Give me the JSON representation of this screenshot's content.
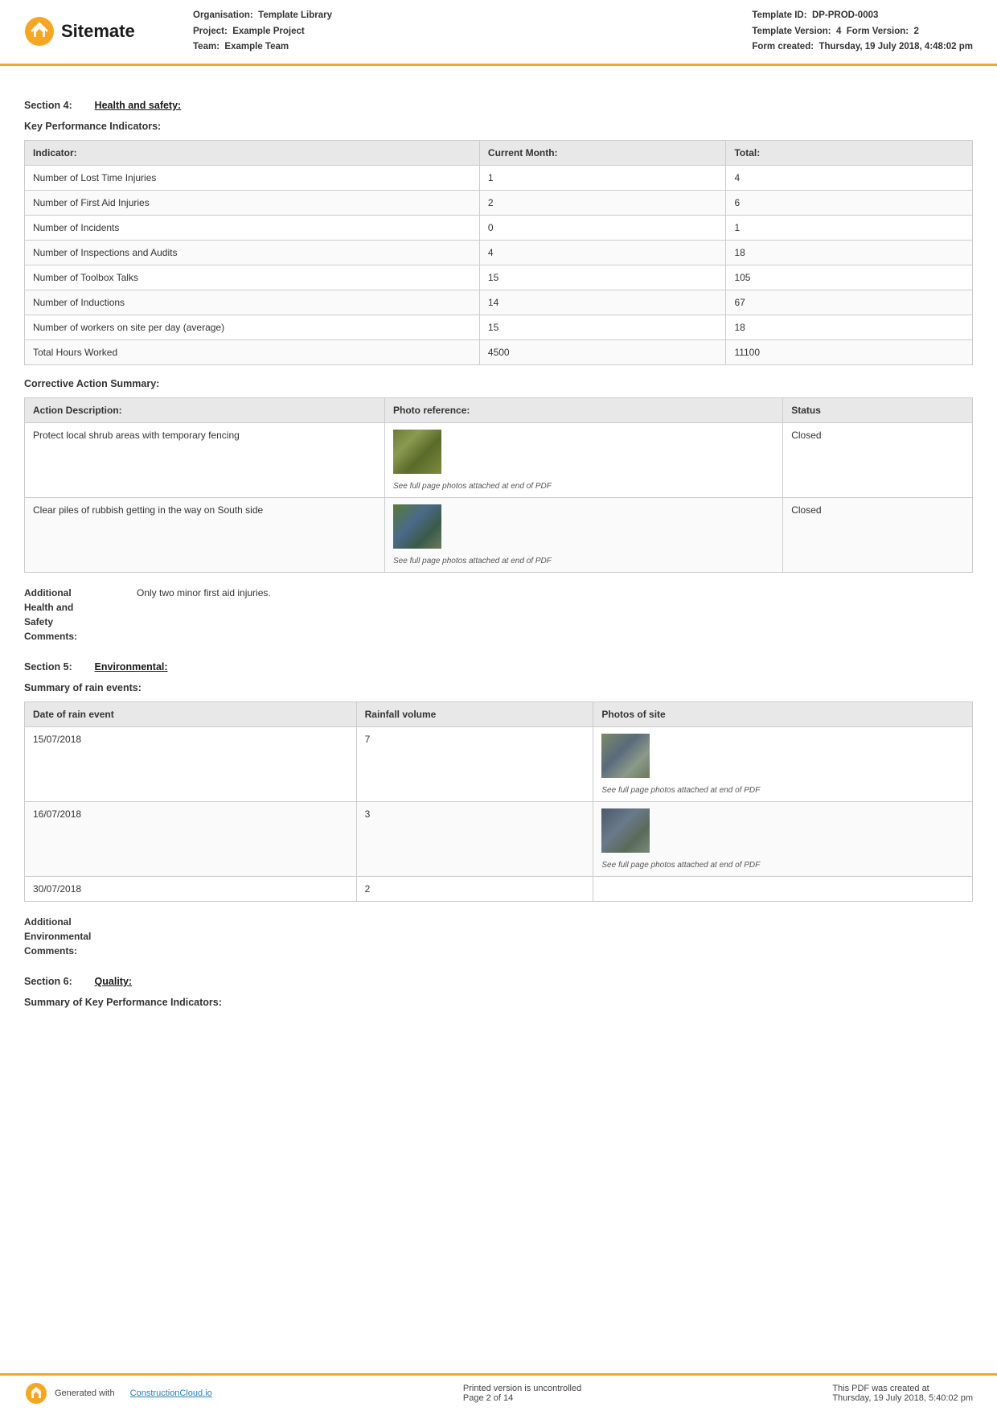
{
  "header": {
    "logo_text": "Sitemate",
    "org_label": "Organisation:",
    "org_value": "Template Library",
    "project_label": "Project:",
    "project_value": "Example Project",
    "team_label": "Team:",
    "team_value": "Example Team",
    "template_id_label": "Template ID:",
    "template_id_value": "DP-PROD-0003",
    "template_version_label": "Template Version:",
    "template_version_value": "4",
    "form_version_label": "Form Version:",
    "form_version_value": "2",
    "form_created_label": "Form created:",
    "form_created_value": "Thursday, 19 July 2018, 4:48:02 pm"
  },
  "section4": {
    "label": "Section 4:",
    "title": "Health and safety:"
  },
  "kpi_heading": "Key Performance Indicators:",
  "kpi_table": {
    "col_indicator": "Indicator:",
    "col_current_month": "Current Month:",
    "col_total": "Total:",
    "rows": [
      {
        "indicator": "Number of Lost Time Injuries",
        "current_month": "1",
        "total": "4"
      },
      {
        "indicator": "Number of First Aid Injuries",
        "current_month": "2",
        "total": "6"
      },
      {
        "indicator": "Number of Incidents",
        "current_month": "0",
        "total": "1"
      },
      {
        "indicator": "Number of Inspections and Audits",
        "current_month": "4",
        "total": "18"
      },
      {
        "indicator": "Number of Toolbox Talks",
        "current_month": "15",
        "total": "105"
      },
      {
        "indicator": "Number of Inductions",
        "current_month": "14",
        "total": "67"
      },
      {
        "indicator": "Number of workers on site per day (average)",
        "current_month": "15",
        "total": "18"
      },
      {
        "indicator": "Total Hours Worked",
        "current_month": "4500",
        "total": "11100"
      }
    ]
  },
  "corrective_action_heading": "Corrective Action Summary:",
  "corrective_action_table": {
    "col_action": "Action Description:",
    "col_photo": "Photo reference:",
    "col_status": "Status",
    "rows": [
      {
        "action": "Protect local shrub areas with temporary fencing",
        "photo_caption": "See full page photos attached at end of PDF",
        "photo_class": "shrub",
        "status": "Closed"
      },
      {
        "action": "Clear piles of rubbish getting in the way on South side",
        "photo_caption": "See full page photos attached at end of PDF",
        "photo_class": "rubbish",
        "status": "Closed"
      }
    ]
  },
  "additional_hs": {
    "label": "Additional\nHealth and\nSafety\nComments:",
    "label_line1": "Additional",
    "label_line2": "Health and",
    "label_line3": "Safety",
    "label_line4": "Comments:",
    "value": "Only two minor first aid injuries."
  },
  "section5": {
    "label": "Section 5:",
    "title": "Environmental:"
  },
  "rain_events_heading": "Summary of rain events:",
  "rain_table": {
    "col_date": "Date of rain event",
    "col_rainfall": "Rainfall volume",
    "col_photos": "Photos of site",
    "rows": [
      {
        "date": "15/07/2018",
        "rainfall": "7",
        "photo_class": "rain1",
        "photo_caption": "See full page photos attached at end of PDF"
      },
      {
        "date": "16/07/2018",
        "rainfall": "3",
        "photo_class": "rain2",
        "photo_caption": "See full page photos attached at end of PDF"
      },
      {
        "date": "30/07/2018",
        "rainfall": "2",
        "photo_class": "",
        "photo_caption": ""
      }
    ]
  },
  "additional_env": {
    "label_line1": "Additional",
    "label_line2": "Environmental",
    "label_line3": "Comments:",
    "value": ""
  },
  "section6": {
    "label": "Section 6:",
    "title": "Quality:"
  },
  "quality_heading": "Summary of Key Performance Indicators:",
  "footer": {
    "generated_label": "Generated with",
    "link_text": "ConstructionCloud.io",
    "uncontrolled": "Printed version is uncontrolled",
    "page": "Page 2 of 14",
    "pdf_created": "This PDF was created at",
    "pdf_datetime": "Thursday, 19 July 2018, 5:40:02 pm"
  }
}
